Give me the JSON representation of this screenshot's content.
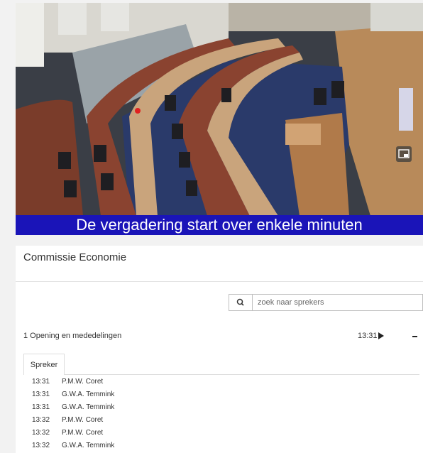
{
  "video": {
    "caption": "De vergadering start over enkele minuten"
  },
  "meeting": {
    "title": "Commissie Economie"
  },
  "search": {
    "placeholder": "zoek naar sprekers",
    "icon": "search-icon"
  },
  "agenda": {
    "item_title": "1 Opening en mededelingen",
    "item_time": "13:31",
    "play_icon": "play-icon",
    "collapse_icon": "minus-icon"
  },
  "speakers": {
    "tab_label": "Spreker",
    "rows": [
      {
        "time": "13:31",
        "name": "P.M.W. Coret"
      },
      {
        "time": "13:31",
        "name": "G.W.A. Temmink"
      },
      {
        "time": "13:31",
        "name": "G.W.A. Temmink"
      },
      {
        "time": "13:32",
        "name": "P.M.W. Coret"
      },
      {
        "time": "13:32",
        "name": "P.M.W. Coret"
      },
      {
        "time": "13:32",
        "name": "G.W.A. Temmink"
      }
    ]
  },
  "colors": {
    "caption_bg": "#1a14b8",
    "page_bg": "#f2f2f2"
  }
}
